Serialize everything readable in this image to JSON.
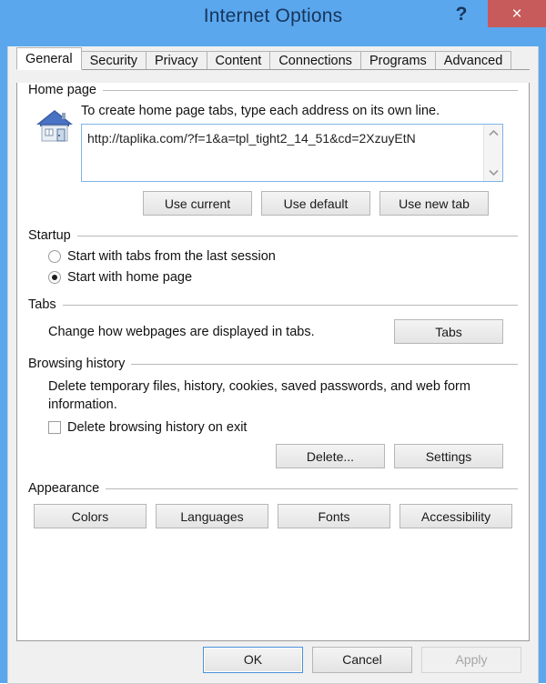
{
  "window": {
    "title": "Internet Options",
    "help_label": "?",
    "close_label": "×"
  },
  "tabs": [
    {
      "label": "General",
      "active": true
    },
    {
      "label": "Security",
      "active": false
    },
    {
      "label": "Privacy",
      "active": false
    },
    {
      "label": "Content",
      "active": false
    },
    {
      "label": "Connections",
      "active": false
    },
    {
      "label": "Programs",
      "active": false
    },
    {
      "label": "Advanced",
      "active": false
    }
  ],
  "home_page": {
    "group_label": "Home page",
    "description": "To create home page tabs, type each address on its own line.",
    "url_value": "http://taplika.com/?f=1&a=tpl_tight2_14_51&cd=2XzuyEtN",
    "scroll_up_icon": "chevron-up-icon",
    "scroll_down_icon": "chevron-down-icon",
    "house_icon": "home-icon",
    "buttons": {
      "use_current": "Use current",
      "use_default": "Use default",
      "use_new_tab": "Use new tab"
    }
  },
  "startup": {
    "group_label": "Startup",
    "options": [
      {
        "label": "Start with tabs from the last session",
        "checked": false
      },
      {
        "label": "Start with home page",
        "checked": true
      }
    ]
  },
  "tabs_section": {
    "group_label": "Tabs",
    "description": "Change how webpages are displayed in tabs.",
    "button_label": "Tabs"
  },
  "browsing_history": {
    "group_label": "Browsing history",
    "description": "Delete temporary files, history, cookies, saved passwords, and web form information.",
    "checkbox_label": "Delete browsing history on exit",
    "checkbox_checked": false,
    "buttons": {
      "delete": "Delete...",
      "settings": "Settings"
    }
  },
  "appearance": {
    "group_label": "Appearance",
    "buttons": [
      {
        "label": "Colors"
      },
      {
        "label": "Languages"
      },
      {
        "label": "Fonts"
      },
      {
        "label": "Accessibility"
      }
    ]
  },
  "footer": {
    "ok": "OK",
    "cancel": "Cancel",
    "apply": "Apply",
    "apply_disabled": true
  },
  "colors": {
    "titlebar": "#5aa7ee",
    "title_text": "#17355a",
    "close_button": "#c75a5a",
    "dialog_bg": "#f0f0f0",
    "page_bg": "#ffffff",
    "focus_border": "#4a90d9",
    "textbox_border": "#7eb4e8"
  }
}
